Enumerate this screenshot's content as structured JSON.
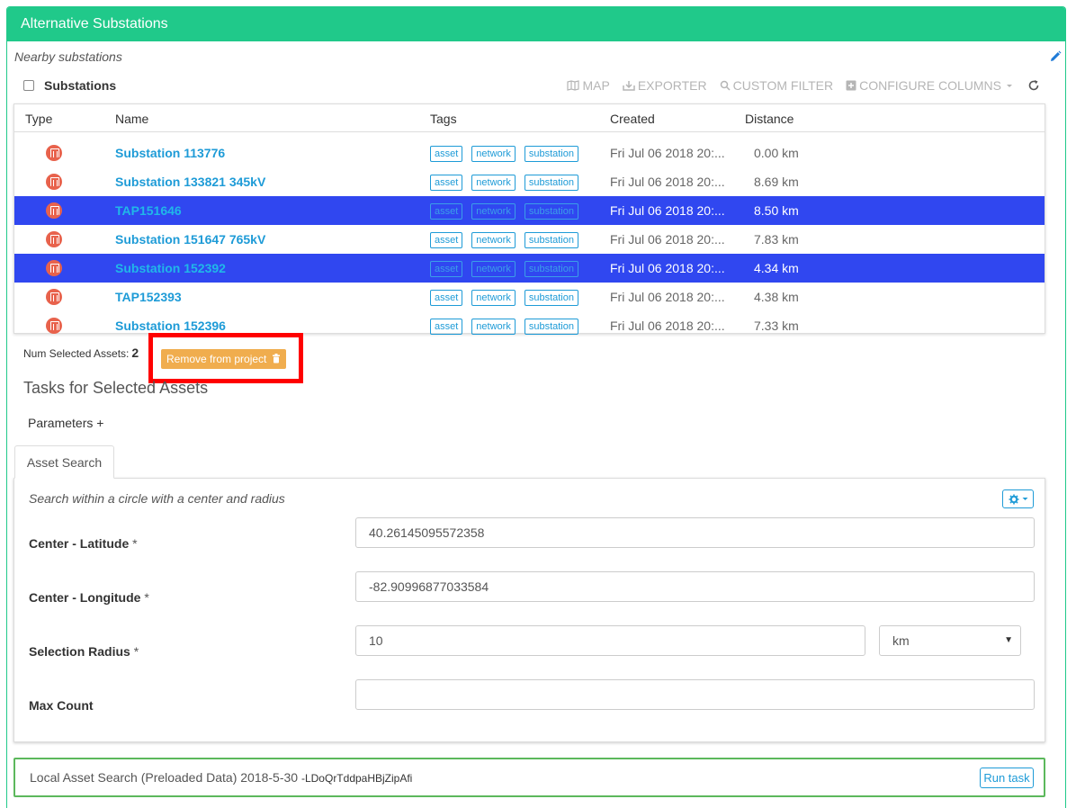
{
  "panel": {
    "title": "Alternative Substations",
    "subtitle": "Nearby substations",
    "header_color": "#20c98a"
  },
  "toolbar": {
    "list_label": "Substations",
    "map_label": "MAP",
    "exporter_label": "EXPORTER",
    "filter_label": "CUSTOM FILTER",
    "columns_label": "CONFIGURE COLUMNS"
  },
  "table": {
    "columns": [
      "Type",
      "Name",
      "Tags",
      "Created",
      "Distance"
    ],
    "rows": [
      {
        "name": "Substation 113776",
        "tags": [
          "asset",
          "network",
          "substation"
        ],
        "created": "Fri Jul 06 2018 20:...",
        "distance": "0.00 km",
        "selected": false
      },
      {
        "name": "Substation 133821 345kV",
        "tags": [
          "asset",
          "network",
          "substation"
        ],
        "created": "Fri Jul 06 2018 20:...",
        "distance": "8.69 km",
        "selected": false
      },
      {
        "name": "TAP151646",
        "tags": [
          "asset",
          "network",
          "substation"
        ],
        "created": "Fri Jul 06 2018 20:...",
        "distance": "8.50 km",
        "selected": true
      },
      {
        "name": "Substation 151647 765kV",
        "tags": [
          "asset",
          "network",
          "substation"
        ],
        "created": "Fri Jul 06 2018 20:...",
        "distance": "7.83 km",
        "selected": false
      },
      {
        "name": "Substation 152392",
        "tags": [
          "asset",
          "network",
          "substation"
        ],
        "created": "Fri Jul 06 2018 20:...",
        "distance": "4.34 km",
        "selected": true
      },
      {
        "name": "TAP152393",
        "tags": [
          "asset",
          "network",
          "substation"
        ],
        "created": "Fri Jul 06 2018 20:...",
        "distance": "4.38 km",
        "selected": false
      },
      {
        "name": "Substation 152396",
        "tags": [
          "asset",
          "network",
          "substation"
        ],
        "created": "Fri Jul 06 2018 20:...",
        "distance": "7.33 km",
        "selected": false
      }
    ],
    "selected_color": "#3047f0"
  },
  "selection": {
    "label": "Num Selected Assets:",
    "count": "2",
    "remove_label": "Remove from project"
  },
  "tasks": {
    "title": "Tasks for Selected Assets",
    "parameters_label": "Parameters +",
    "tab_label": "Asset Search",
    "description": "Search within a circle with a center and radius",
    "fields": {
      "lat_label": "Center - Latitude",
      "lat_value": "40.26145095572358",
      "lon_label": "Center - Longitude",
      "lon_value": "-82.90996877033584",
      "radius_label": "Selection Radius",
      "radius_value": "10",
      "radius_unit": "km",
      "max_label": "Max Count",
      "max_value": "",
      "required_mark": "*"
    }
  },
  "local_task": {
    "title": "Local Asset Search (Preloaded Data) 2018-5-30",
    "code": "-LDoQrTddpaHBjZipAfi",
    "run_label": "Run task"
  }
}
